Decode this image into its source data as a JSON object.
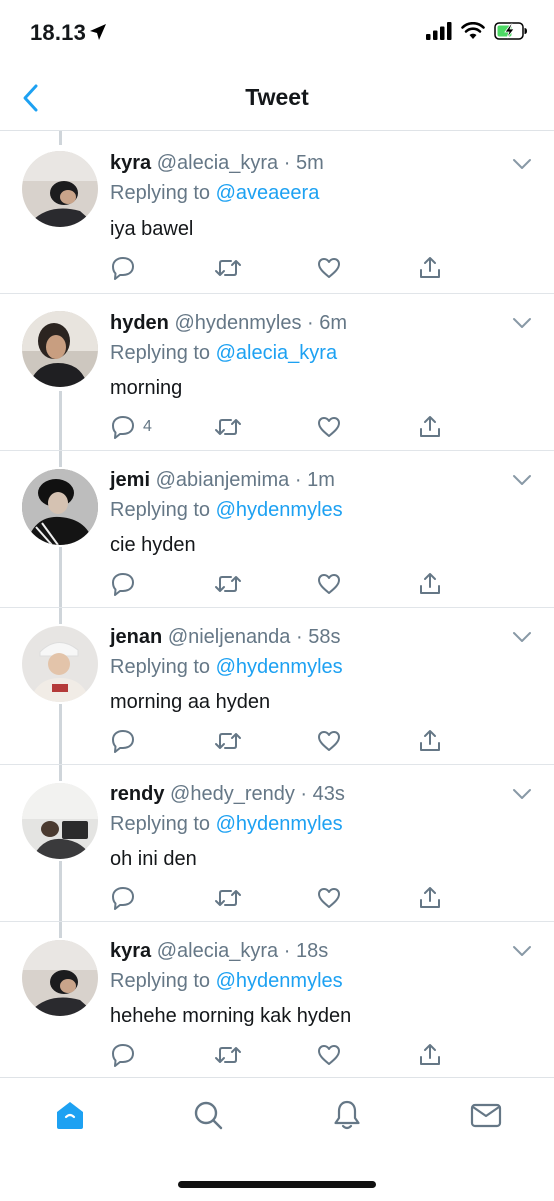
{
  "status": {
    "time": "18.13"
  },
  "nav": {
    "title": "Tweet",
    "back_icon": "chevron-left-icon"
  },
  "colors": {
    "accent": "#1da1f2",
    "muted": "#657786",
    "text": "#14171a",
    "battery": "#4cd964"
  },
  "tweets": [
    {
      "name": "kyra",
      "handle": "@alecia_kyra",
      "time": "5m",
      "replying_label": "Replying to",
      "replying_to": "@aveaeera",
      "text": "iya bawel",
      "reply_count": ""
    },
    {
      "name": "hyden",
      "handle": "@hydenmyles",
      "time": "6m",
      "replying_label": "Replying to",
      "replying_to": "@alecia_kyra",
      "text": "morning",
      "reply_count": "4"
    },
    {
      "name": "jemi",
      "handle": "@abianjemima",
      "time": "1m",
      "replying_label": "Replying to",
      "replying_to": "@hydenmyles",
      "text": "cie hyden",
      "reply_count": ""
    },
    {
      "name": "jenan",
      "handle": "@nieljenanda",
      "time": "58s",
      "replying_label": "Replying to",
      "replying_to": "@hydenmyles",
      "text": "morning aa hyden",
      "reply_count": ""
    },
    {
      "name": "rendy",
      "handle": "@hedy_rendy",
      "time": "43s",
      "replying_label": "Replying to",
      "replying_to": "@hydenmyles",
      "text": "oh ini den",
      "reply_count": ""
    },
    {
      "name": "kyra",
      "handle": "@alecia_kyra",
      "time": "18s",
      "replying_label": "Replying to",
      "replying_to": "@hydenmyles",
      "text": "hehehe morning kak hyden",
      "reply_count": ""
    }
  ],
  "tabs": [
    {
      "icon": "home-icon",
      "active": true
    },
    {
      "icon": "search-icon",
      "active": false
    },
    {
      "icon": "bell-icon",
      "active": false
    },
    {
      "icon": "mail-icon",
      "active": false
    }
  ]
}
